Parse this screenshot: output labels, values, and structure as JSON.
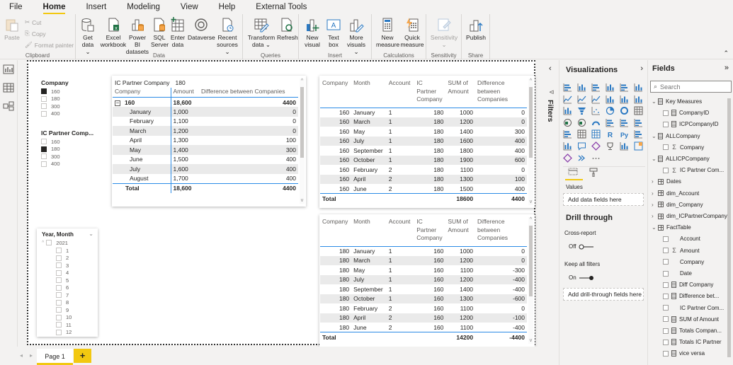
{
  "menu": {
    "tabs": [
      "File",
      "Home",
      "Insert",
      "Modeling",
      "View",
      "Help",
      "External Tools"
    ],
    "active": "Home"
  },
  "ribbon": {
    "clipboard": {
      "label": "Clipboard",
      "paste": "Paste",
      "cut": "Cut",
      "copy": "Copy",
      "format_painter": "Format painter"
    },
    "data": {
      "label": "Data",
      "get_data": [
        "Get",
        "data ⌄"
      ],
      "excel": [
        "Excel",
        "workbook"
      ],
      "powerbi": [
        "Power BI",
        "datasets"
      ],
      "sql": [
        "SQL",
        "Server"
      ],
      "enter": [
        "Enter",
        "data"
      ],
      "dataverse": [
        "Dataverse",
        ""
      ],
      "recent": [
        "Recent",
        "sources ⌄"
      ]
    },
    "queries": {
      "label": "Queries",
      "transform": [
        "Transform",
        "data ⌄"
      ],
      "refresh": [
        "Refresh",
        ""
      ]
    },
    "insert": {
      "label": "Insert",
      "new_visual": [
        "New",
        "visual"
      ],
      "text_box": [
        "Text",
        "box"
      ],
      "more_visuals": [
        "More",
        "visuals ⌄"
      ]
    },
    "calculations": {
      "label": "Calculations",
      "new_measure": [
        "New",
        "measure"
      ],
      "quick_measure": [
        "Quick",
        "measure"
      ]
    },
    "sensitivity": {
      "label": "Sensitivity",
      "btn": [
        "Sensitivity",
        "⌄"
      ]
    },
    "share": {
      "label": "Share",
      "publish": [
        "Publish",
        ""
      ]
    }
  },
  "slicers": {
    "company": {
      "title": "Company",
      "items": [
        {
          "label": "160",
          "checked": true
        },
        {
          "label": "180",
          "checked": false
        },
        {
          "label": "300",
          "checked": false
        },
        {
          "label": "400",
          "checked": false
        }
      ]
    },
    "ic_partner": {
      "title": "IC Partner Comp...",
      "items": [
        {
          "label": "160",
          "checked": false
        },
        {
          "label": "180",
          "checked": true
        },
        {
          "label": "300",
          "checked": false
        },
        {
          "label": "400",
          "checked": false
        }
      ]
    },
    "year_month": {
      "title": "Year, Month",
      "year": "2021",
      "months": [
        "1",
        "2",
        "3",
        "4",
        "5",
        "6",
        "7",
        "8",
        "9",
        "10",
        "11",
        "12"
      ]
    }
  },
  "matrix": {
    "header_line1": [
      "IC Partner Company",
      "180"
    ],
    "headers": [
      "Company",
      "Amount",
      "Difference between Companies"
    ],
    "group": {
      "label": "160",
      "amount": "18,600",
      "diff": "4400"
    },
    "rows": [
      [
        "January",
        "1,000",
        "0"
      ],
      [
        "February",
        "1,100",
        "0"
      ],
      [
        "March",
        "1,200",
        "0"
      ],
      [
        "April",
        "1,300",
        "100"
      ],
      [
        "May",
        "1,400",
        "300"
      ],
      [
        "June",
        "1,500",
        "400"
      ],
      [
        "July",
        "1,600",
        "400"
      ],
      [
        "August",
        "1,700",
        "400"
      ]
    ],
    "total": [
      "Total",
      "18,600",
      "4400"
    ]
  },
  "table1": {
    "headers": [
      "Company",
      "Month",
      "Account",
      "IC Partner Company",
      "SUM of Amount",
      "Difference between Companies"
    ],
    "rows": [
      [
        "160",
        "January",
        "1",
        "180",
        "1000",
        "0"
      ],
      [
        "160",
        "March",
        "1",
        "180",
        "1200",
        "0"
      ],
      [
        "160",
        "May",
        "1",
        "180",
        "1400",
        "300"
      ],
      [
        "160",
        "July",
        "1",
        "180",
        "1600",
        "400"
      ],
      [
        "160",
        "September",
        "1",
        "180",
        "1800",
        "400"
      ],
      [
        "160",
        "October",
        "1",
        "180",
        "1900",
        "600"
      ],
      [
        "160",
        "February",
        "2",
        "180",
        "1100",
        "0"
      ],
      [
        "160",
        "April",
        "2",
        "180",
        "1300",
        "100"
      ],
      [
        "160",
        "June",
        "2",
        "180",
        "1500",
        "400"
      ]
    ],
    "total": [
      "Total",
      "",
      "",
      "",
      "18600",
      "4400"
    ]
  },
  "table2": {
    "headers": [
      "Company",
      "Month",
      "Account",
      "IC Partner Company",
      "SUM of Amount",
      "Difference between Companies"
    ],
    "rows": [
      [
        "180",
        "January",
        "1",
        "160",
        "1000",
        "0"
      ],
      [
        "180",
        "March",
        "1",
        "160",
        "1200",
        "0"
      ],
      [
        "180",
        "May",
        "1",
        "160",
        "1100",
        "-300"
      ],
      [
        "180",
        "July",
        "1",
        "160",
        "1200",
        "-400"
      ],
      [
        "180",
        "September",
        "1",
        "160",
        "1400",
        "-400"
      ],
      [
        "180",
        "October",
        "1",
        "160",
        "1300",
        "-600"
      ],
      [
        "180",
        "February",
        "2",
        "160",
        "1100",
        "0"
      ],
      [
        "180",
        "April",
        "2",
        "160",
        "1200",
        "-100"
      ],
      [
        "180",
        "June",
        "2",
        "160",
        "1100",
        "-400"
      ]
    ],
    "total": [
      "Total",
      "",
      "",
      "",
      "14200",
      "-4400"
    ]
  },
  "filters": {
    "label": "Filters"
  },
  "visualizations": {
    "title": "Visualizations",
    "values_label": "Values",
    "add_data": "Add data fields here",
    "drill_title": "Drill through",
    "cross_report": "Cross-report",
    "cross_state": "Off",
    "keep_filters": "Keep all filters",
    "keep_state": "On",
    "add_drill": "Add drill-through fields here",
    "icons": [
      "stacked-bar",
      "stacked-column",
      "clustered-bar",
      "clustered-column",
      "100-bar",
      "100-column",
      "line",
      "area",
      "stacked-area",
      "line-column",
      "line-clustered-column",
      "ribbon",
      "waterfall",
      "funnel",
      "scatter",
      "pie",
      "donut",
      "treemap",
      "map",
      "filled-map",
      "gauge",
      "card",
      "multi-row-card",
      "kpi",
      "slicer",
      "table",
      "matrix",
      "r-visual",
      "python-visual",
      "key-influencers",
      "decomposition-tree",
      "qa",
      "smart-narrative",
      "trophy",
      "paginated",
      "power-automate",
      "power-apps",
      "narrative",
      "more"
    ]
  },
  "fields": {
    "title": "Fields",
    "search_placeholder": "Search",
    "items": [
      {
        "label": "Key Measures",
        "type": "table-calc",
        "level": 0,
        "expanded": true
      },
      {
        "label": "CompanyID",
        "type": "calc",
        "level": 1
      },
      {
        "label": "ICPCompanyID",
        "type": "calc",
        "level": 1
      },
      {
        "label": "ALLCompany",
        "type": "table-calc",
        "level": 0,
        "expanded": true
      },
      {
        "label": "Company",
        "type": "sigma",
        "level": 1
      },
      {
        "label": "ALLICPCompany",
        "type": "table-calc",
        "level": 0,
        "expanded": true
      },
      {
        "label": "IC Partner Com...",
        "type": "sigma",
        "level": 1
      },
      {
        "label": "Dates",
        "type": "table",
        "level": 0,
        "expanded": false
      },
      {
        "label": "dim_Account",
        "type": "table",
        "level": 0,
        "expanded": false
      },
      {
        "label": "dim_Company",
        "type": "table",
        "level": 0,
        "expanded": false
      },
      {
        "label": "dim_ICPartnerCompany",
        "type": "table",
        "level": 0,
        "expanded": false
      },
      {
        "label": "FactTable",
        "type": "table",
        "level": 0,
        "expanded": true
      },
      {
        "label": "Account",
        "type": "none",
        "level": 1
      },
      {
        "label": "Amount",
        "type": "sigma",
        "level": 1
      },
      {
        "label": "Company",
        "type": "none",
        "level": 1
      },
      {
        "label": "Date",
        "type": "none",
        "level": 1
      },
      {
        "label": "Diff Company",
        "type": "calc",
        "level": 1
      },
      {
        "label": "Difference bet...",
        "type": "calc",
        "level": 1
      },
      {
        "label": "IC Partner Com...",
        "type": "none",
        "level": 1
      },
      {
        "label": "SUM of Amount",
        "type": "calc",
        "level": 1
      },
      {
        "label": "Totals Compan...",
        "type": "calc",
        "level": 1
      },
      {
        "label": "Totals IC Partner",
        "type": "calc",
        "level": 1
      },
      {
        "label": "vice versa",
        "type": "calc",
        "level": 1
      }
    ]
  },
  "pages": {
    "tabs": [
      "Page 1"
    ],
    "add": "+"
  },
  "colors": {
    "accent": "#f2c811",
    "table_line": "#2b8be6",
    "icon_blue": "#2b79c2"
  }
}
